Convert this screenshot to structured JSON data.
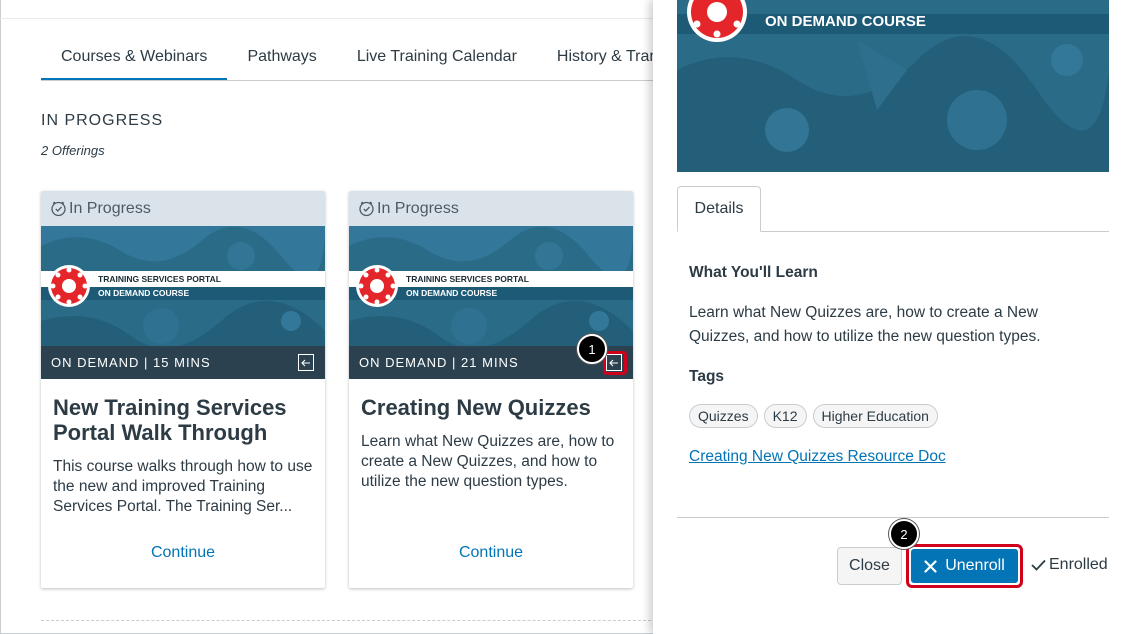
{
  "tabs": [
    {
      "label": "Courses & Webinars",
      "active": true
    },
    {
      "label": "Pathways",
      "active": false
    },
    {
      "label": "Live Training Calendar",
      "active": false
    },
    {
      "label": "History & Trans",
      "active": false
    }
  ],
  "section": {
    "title": "IN PROGRESS",
    "subtitle": "2 Offerings"
  },
  "cards": [
    {
      "status": "In Progress",
      "banner_title": "TRAINING SERVICES PORTAL",
      "banner_subtitle": "ON DEMAND COURSE",
      "meta": "ON DEMAND | 15 MINS",
      "title": "New Training Services Portal Walk Through",
      "description": "This course walks through how to use the new and improved Training Services Portal. The Training Ser...",
      "cta": "Continue"
    },
    {
      "status": "In Progress",
      "banner_title": "TRAINING SERVICES PORTAL",
      "banner_subtitle": "ON DEMAND COURSE",
      "meta": "ON DEMAND | 21 MINS",
      "title": "Creating New Quizzes",
      "description": "Learn what New Quizzes are, how to create a New Quizzes, and how to utilize the new question types.",
      "cta": "Continue"
    }
  ],
  "callouts": {
    "one": "1",
    "two": "2"
  },
  "tray": {
    "banner_subtitle": "ON DEMAND COURSE",
    "tab_label": "Details",
    "learn_heading": "What You'll Learn",
    "learn_text": "Learn what New Quizzes are, how to create a New Quizzes, and how to utilize the new question types.",
    "tags_heading": "Tags",
    "tags": [
      "Quizzes",
      "K12",
      "Higher Education"
    ],
    "resource_link": "Creating New Quizzes Resource Doc",
    "close_label": "Close",
    "unenroll_label": "Unenroll",
    "enrolled_label": "Enrolled"
  },
  "colors": {
    "accent": "#0374b5",
    "highlight": "#d0021b",
    "banner": "#2a6c88"
  }
}
